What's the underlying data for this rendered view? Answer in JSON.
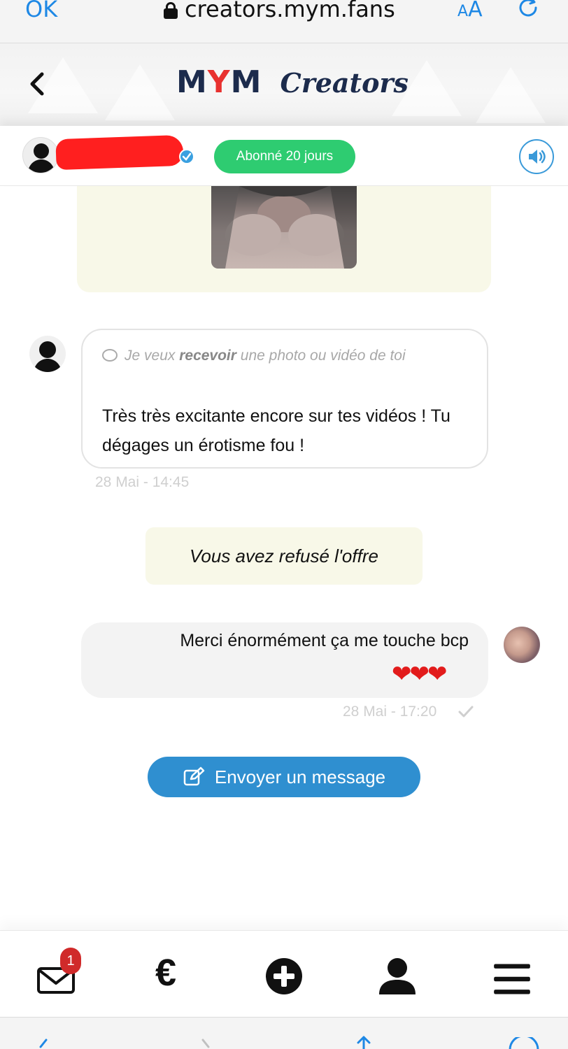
{
  "browser": {
    "ok_label": "OK",
    "url": "creators.mym.fans",
    "text_size_small": "A",
    "text_size_big": "A"
  },
  "header": {
    "logo_mym_m1": "M",
    "logo_mym_y": "Y",
    "logo_mym_m2": "M",
    "logo_creators": "Creators"
  },
  "contact": {
    "subscription_badge": "Abonné 20 jours"
  },
  "messages": {
    "incoming": {
      "request_prefix": "Je veux ",
      "request_bold": "recevoir",
      "request_suffix": " une photo ou vidéo de toi",
      "text": "Très très excitante encore sur tes vidéos ! Tu dégages un érotisme fou !",
      "time": "28 Mai - 14:45"
    },
    "system_notice": "Vous avez refusé l'offre",
    "outgoing": {
      "text": "Merci énormément ça me touche bcp",
      "emoji": "❤❤❤",
      "time": "28 Mai - 17:20"
    }
  },
  "send_button": {
    "label": "Envoyer un message"
  },
  "bottom_nav": {
    "mail_badge": "1",
    "euro_glyph": "€"
  },
  "colors": {
    "accent_blue": "#2f8fd0",
    "badge_green": "#2ecc71",
    "alert_red": "#d02a2a",
    "brand_navy": "#1c2b4c",
    "brand_red": "#e8312f"
  }
}
